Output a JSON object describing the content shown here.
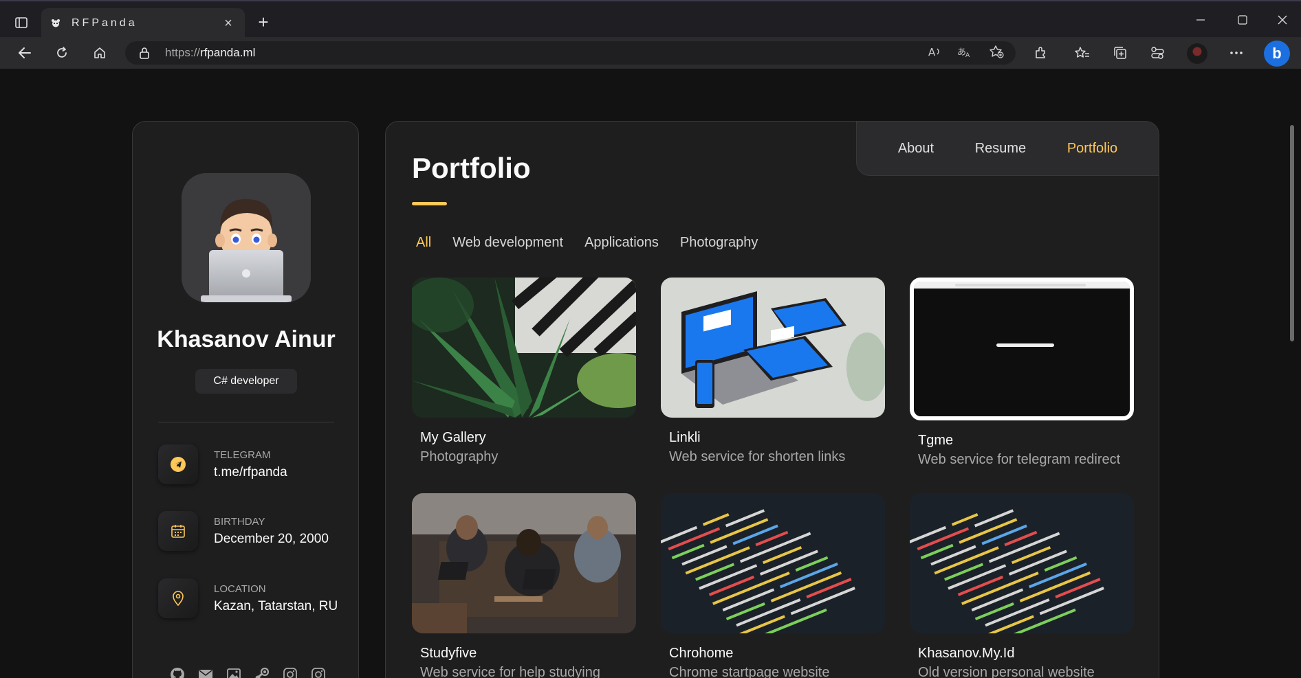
{
  "browser": {
    "tab_title": "RFPanda",
    "url_protocol": "https://",
    "url_host": "rfpanda.ml"
  },
  "profile": {
    "name": "Khasanov Ainur",
    "role": "C# developer",
    "contacts": [
      {
        "label": "Telegram",
        "value": "t.me/rfpanda",
        "icon": "telegram-icon"
      },
      {
        "label": "Birthday",
        "value": "December 20, 2000",
        "icon": "calendar-icon"
      },
      {
        "label": "Location",
        "value": "Kazan, Tatarstan, RU",
        "icon": "location-pin-icon"
      }
    ],
    "socials": [
      "github-icon",
      "mail-icon",
      "gallery-icon",
      "steam-icon",
      "instagram-icon",
      "instagram-icon"
    ]
  },
  "nav": {
    "items": [
      "About",
      "Resume",
      "Portfolio"
    ],
    "active": "Portfolio"
  },
  "portfolio": {
    "title": "Portfolio",
    "filters": [
      "All",
      "Web development",
      "Applications",
      "Photography"
    ],
    "active_filter": "All",
    "projects": [
      {
        "title": "My Gallery",
        "category": "Photography"
      },
      {
        "title": "Linkli",
        "category": "Web service for shorten links"
      },
      {
        "title": "Tgme",
        "category": "Web service for telegram redirect"
      },
      {
        "title": "Studyfive",
        "category": "Web service for help studying"
      },
      {
        "title": "Chrohome",
        "category": "Chrome startpage website"
      },
      {
        "title": "Khasanov.My.Id",
        "category": "Old version personal website"
      }
    ]
  },
  "colors": {
    "accent": "#ffc857",
    "panel": "#1e1e1f",
    "background": "#121212"
  }
}
